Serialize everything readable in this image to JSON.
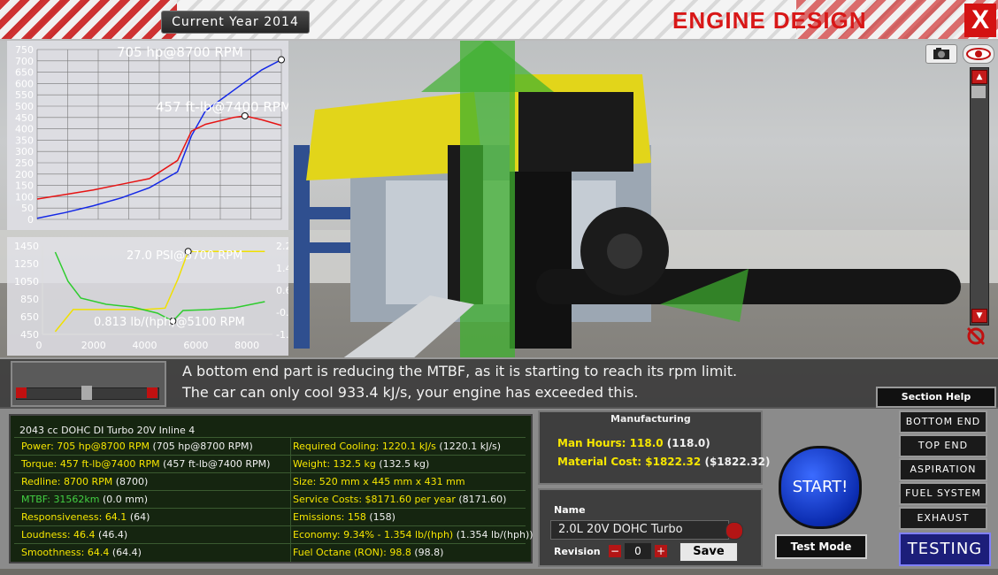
{
  "header": {
    "current_year": "Current Year 2014",
    "title": "ENGINE DESIGN",
    "close_label": "X"
  },
  "messages": [
    "A bottom end part is reducing the MTBF, as it is starting to reach its rpm limit.",
    "The car can only cool 933.4 kJ/s, your engine has exceeded this."
  ],
  "stats": {
    "engine_name": "2043 cc DOHC DI Turbo 20V Inline 4",
    "rows": [
      {
        "left_label": "Power:",
        "left_value": "705 hp@8700 RPM",
        "left_extra": "(705 hp@8700 RPM)",
        "left_color": "y",
        "right_label": "Required Cooling:",
        "right_value": "1220.1 kJ/s",
        "right_extra": "(1220.1 kJ/s)",
        "right_color": "y"
      },
      {
        "left_label": "Torque:",
        "left_value": "457 ft-lb@7400 RPM",
        "left_extra": "(457 ft-lb@7400 RPM)",
        "left_color": "y",
        "right_label": "Weight:",
        "right_value": "132.5 kg",
        "right_extra": "(132.5 kg)",
        "right_color": "y"
      },
      {
        "left_label": "Redline:",
        "left_value": "8700 RPM",
        "left_extra": "(8700)",
        "left_color": "y",
        "right_label": "Size:",
        "right_value": "520 mm x 445 mm x 431 mm",
        "right_extra": "",
        "right_color": "y"
      },
      {
        "left_label": "MTBF:",
        "left_value": "31562km",
        "left_extra": "(0.0 mm)",
        "left_color": "g",
        "right_label": "Service Costs:",
        "right_value": "$8171.60 per year",
        "right_extra": "(8171.60)",
        "right_color": "y"
      },
      {
        "left_label": "Responsiveness:",
        "left_value": "64.1",
        "left_extra": "(64)",
        "left_color": "y",
        "right_label": "Emissions:",
        "right_value": "158",
        "right_extra": "(158)",
        "right_color": "y"
      },
      {
        "left_label": "Loudness:",
        "left_value": "46.4",
        "left_extra": "(46.4)",
        "left_color": "y",
        "right_label": "Economy:",
        "right_value": "9.34% - 1.354 lb/(hph)",
        "right_extra": "(1.354 lb/(hph))",
        "right_color": "y"
      },
      {
        "left_label": "Smoothness:",
        "left_value": "64.4",
        "left_extra": "(64.4)",
        "left_color": "y",
        "right_label": "Fuel Octane (RON):",
        "right_value": "98.8",
        "right_extra": "(98.8)",
        "right_color": "y"
      }
    ]
  },
  "manufacturing": {
    "title": "Manufacturing",
    "man_hours_label": "Man Hours:",
    "man_hours": "118.0",
    "man_hours_extra": "(118.0)",
    "material_cost_label": "Material Cost:",
    "material_cost": "$1822.32",
    "material_cost_extra": "($1822.32)"
  },
  "naming": {
    "name_label": "Name",
    "name_value": "2.0L 20V DOHC Turbo",
    "revision_label": "Revision",
    "revision_value": "0",
    "minus": "−",
    "plus": "+",
    "save_label": "Save"
  },
  "controls": {
    "start_label": "START!",
    "test_mode_label": "Test Mode",
    "section_help_label": "Section Help",
    "sections": [
      "BOTTOM END",
      "TOP END",
      "ASPIRATION",
      "FUEL SYSTEM",
      "EXHAUST"
    ],
    "testing_label": "TESTING"
  },
  "icons": {
    "camera": "camera-icon",
    "eye": "eye-icon",
    "scroll_up": "arrow-up-icon",
    "scroll_down": "arrow-down-icon",
    "reset": "reset-icon"
  },
  "colors": {
    "power": "#1428e6",
    "torque": "#e61414",
    "boost": "#f0e000",
    "economy": "#2ecc2e",
    "title_red": "#d81818"
  },
  "chart_data": [
    {
      "type": "line",
      "annotations": [
        "705 hp@8700 RPM",
        "457 ft-lb@7400 RPM"
      ],
      "ylim": [
        0,
        750
      ],
      "xlim": [
        0,
        8700
      ],
      "yticks": [
        "750",
        "700",
        "650",
        "600",
        "550",
        "500",
        "450",
        "400",
        "350",
        "300",
        "250",
        "200",
        "150",
        "100",
        "50",
        "0"
      ],
      "series": [
        {
          "name": "Power",
          "color": "#1428e6",
          "x": [
            0,
            1000,
            2000,
            3000,
            4000,
            5000,
            5500,
            6000,
            7000,
            8000,
            8700
          ],
          "values": [
            5,
            30,
            60,
            95,
            140,
            210,
            370,
            480,
            570,
            660,
            705
          ]
        },
        {
          "name": "Torque",
          "color": "#e61414",
          "x": [
            0,
            1000,
            2000,
            3000,
            4000,
            5000,
            5500,
            6000,
            7000,
            7400,
            8000,
            8700
          ],
          "values": [
            90,
            110,
            130,
            155,
            180,
            260,
            390,
            420,
            450,
            457,
            440,
            415
          ]
        }
      ]
    },
    {
      "type": "line",
      "annotations": [
        "27.0 PSI@5700 RPM",
        "0.813 lb/(hph)@5100 RPM"
      ],
      "xlim": [
        0,
        9000
      ],
      "xticks": [
        "2000",
        "4000",
        "6000",
        "8000"
      ],
      "y_left_ticks": [
        "1450",
        "1250",
        "1050",
        "850",
        "650",
        "450"
      ],
      "y_right_ticks": [
        "2.2",
        "1.4",
        "0.6",
        "-0.2",
        "-1.0"
      ],
      "y_left_lim": [
        450,
        1450
      ],
      "y_right_lim": [
        -1.0,
        2.2
      ],
      "series": [
        {
          "name": "Boost",
          "color": "#f0e000",
          "axis": "right",
          "x": [
            500,
            1200,
            2000,
            3000,
            4000,
            4800,
            5300,
            5700,
            6000,
            8700
          ],
          "values": [
            -0.9,
            -0.1,
            -0.1,
            -0.1,
            -0.1,
            -0.05,
            1.0,
            2.0,
            2.0,
            2.0
          ]
        },
        {
          "name": "Economy",
          "color": "#2ecc2e",
          "axis": "left",
          "x": [
            500,
            1000,
            1500,
            2500,
            3500,
            4500,
            5100,
            5500,
            6500,
            7500,
            8700
          ],
          "values": [
            1380,
            1050,
            860,
            790,
            760,
            690,
            600,
            720,
            730,
            750,
            820
          ]
        }
      ]
    }
  ]
}
